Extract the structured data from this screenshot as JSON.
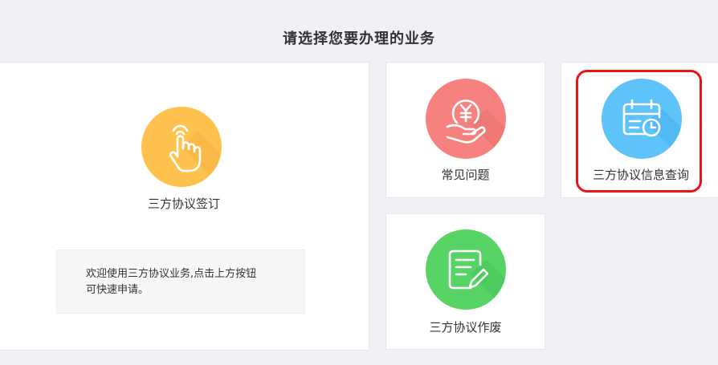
{
  "page": {
    "title": "请选择您要办理的业务"
  },
  "cards": {
    "sign": {
      "label": "三方协议签订",
      "icon": "hand-pointer-icon",
      "color": "#ffc24f"
    },
    "faq": {
      "label": "常见问题",
      "icon": "yuan-coin-hand-icon",
      "color": "#f6817e"
    },
    "query": {
      "label": "三方协议信息查询",
      "icon": "calendar-clock-icon",
      "color": "#5ec3f9"
    },
    "cancel": {
      "label": "三方协议作废",
      "icon": "document-edit-icon",
      "color": "#58d467"
    }
  },
  "info": {
    "line1": "欢迎使用三方协议业务,点击上方按钮",
    "line2": "可快速申请。"
  },
  "highlight_color": "#e81416"
}
